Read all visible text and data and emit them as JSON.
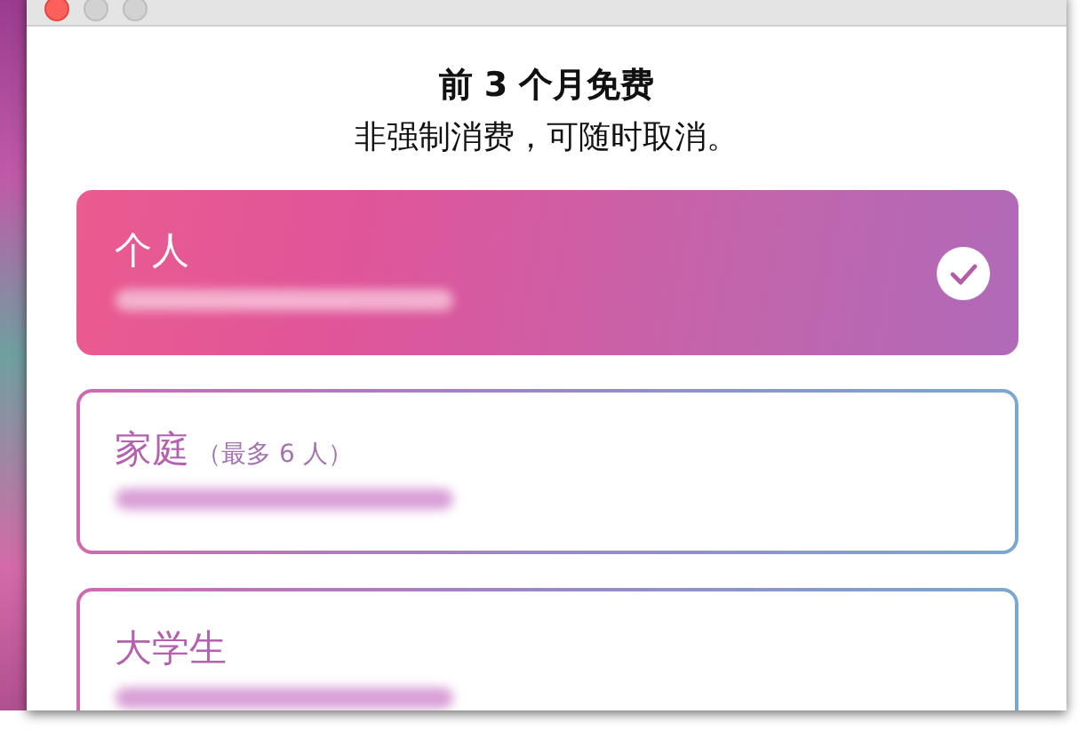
{
  "heading": {
    "title": "前 3 个月免费",
    "subtitle": "非强制消费，可随时取消。"
  },
  "plans": [
    {
      "name": "个人",
      "selected": true
    },
    {
      "name": "家庭",
      "note": "（最多 6 人）",
      "selected": false
    },
    {
      "name": "大学生",
      "selected": false
    }
  ]
}
